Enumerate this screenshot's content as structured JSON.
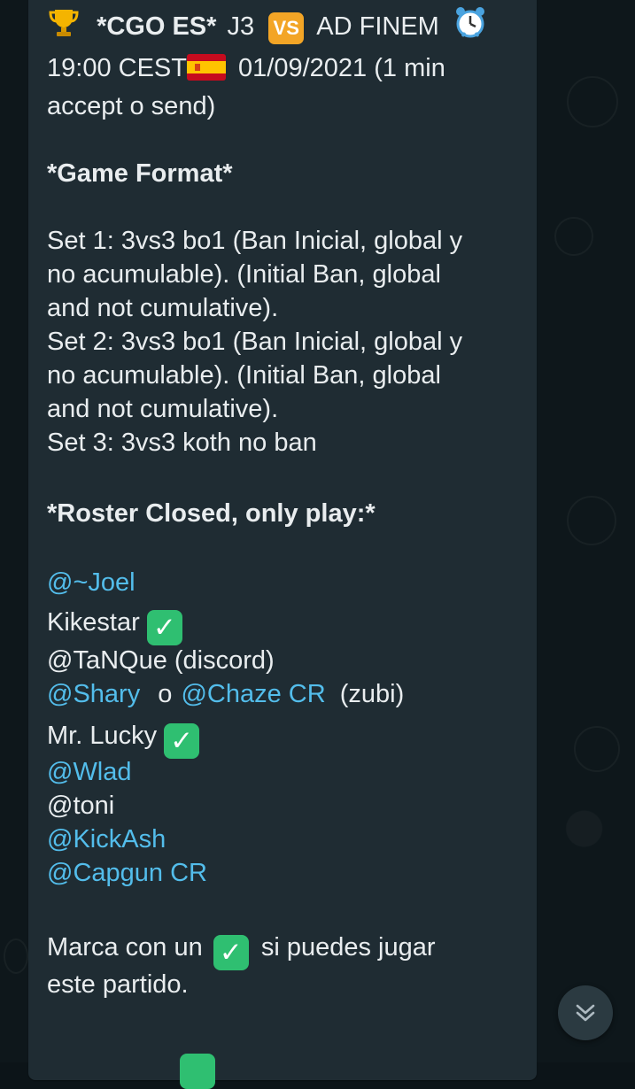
{
  "message": {
    "header_line_1": {
      "bold_text": "*CGO ES*",
      "after_bold": "J3",
      "after_vs": "AD FINEM"
    },
    "header_line_2": {
      "time": "19:00 CEST",
      "date": "01/09/2021 (1 min"
    },
    "header_line_3": "accept o send)",
    "game_format_title": "*Game Format*",
    "sets": [
      "Set 1: 3vs3 bo1 (Ban Inicial, global y",
      "no acumulable). (Initial Ban, global",
      "and not cumulative).",
      "Set 2: 3vs3 bo1 (Ban Inicial, global y",
      "no acumulable). (Initial Ban, global",
      "and not cumulative).",
      "Set 3: 3vs3 koth no ban"
    ],
    "roster_title": "*Roster Closed, only play:*",
    "roster": {
      "joel": "@~Joel",
      "kikestar": "Kikestar",
      "tanque": "@TaNQue (discord)",
      "shary": "@Shary",
      "or_word": "o",
      "chaze": "@Chaze CR",
      "zubi": "(zubi)",
      "mr_lucky": "Mr. Lucky",
      "wlad": "@Wlad",
      "toni": "@toni",
      "kickash": "@KickAsh",
      "capgun": "@Capgun CR"
    },
    "footer_line_1_before": "Marca con un",
    "footer_line_1_after": "si puedes jugar",
    "footer_line_2": "este partido."
  },
  "icons": {
    "trophy": "trophy-icon",
    "vs": "vs-icon",
    "alarm_clock": "alarm-clock-icon",
    "spain_flag": "spain-flag-icon",
    "check_mark": "check-mark-icon",
    "scroll_down": "chevron-double-down-icon"
  },
  "vs_label": "VS",
  "colors": {
    "bubble": "#1f2c33",
    "mention": "#53bdeb",
    "check": "#2fbf71",
    "vs": "#f3a526"
  }
}
